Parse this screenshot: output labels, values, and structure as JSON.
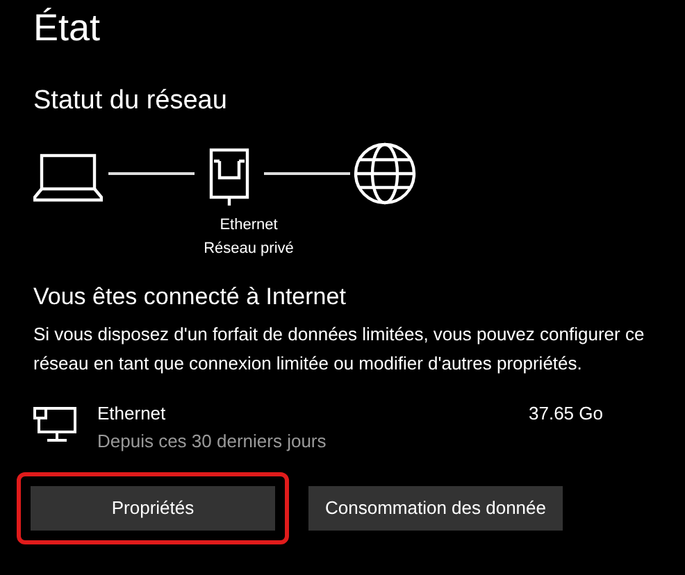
{
  "page": {
    "title": "État"
  },
  "network_status": {
    "heading": "Statut du réseau",
    "adapter_label": "Ethernet",
    "network_type": "Réseau privé"
  },
  "connection": {
    "heading": "Vous êtes connecté à Internet",
    "description": "Si vous disposez d'un forfait de données limitées, vous pouvez configurer ce réseau en tant que connexion limitée ou modifier d'autres propriétés."
  },
  "usage": {
    "name": "Ethernet",
    "period": "Depuis ces 30 derniers jours",
    "amount": "37.65 Go"
  },
  "buttons": [
    {
      "label": "Propriétés",
      "highlighted": true
    },
    {
      "label": "Consommation des donnée",
      "highlighted": false
    }
  ]
}
